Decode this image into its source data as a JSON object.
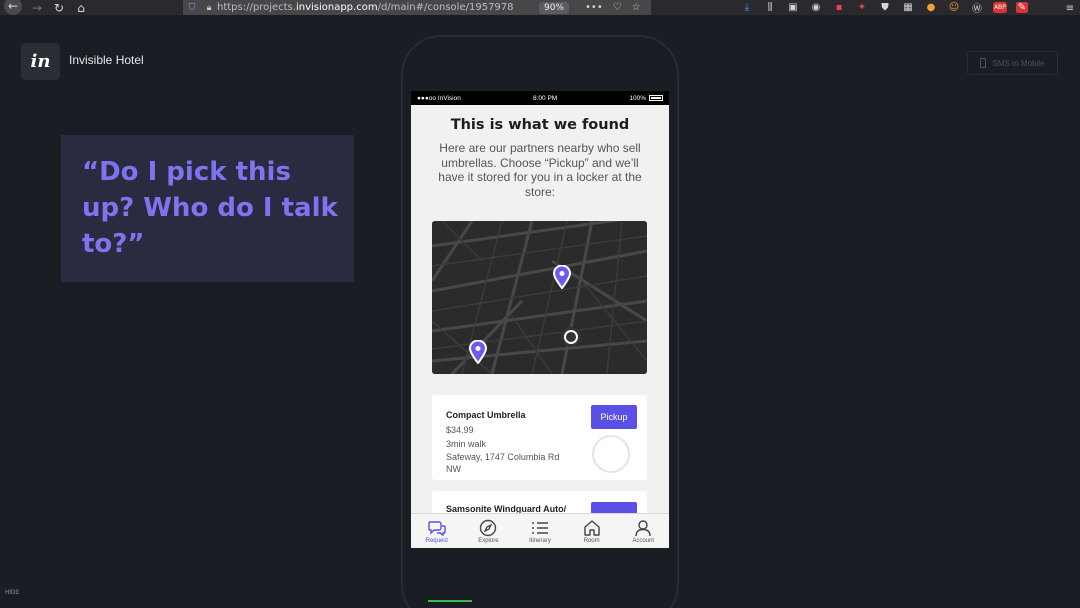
{
  "browser": {
    "url_prefix": "https://projects.",
    "url_domain": "invisionapp.com",
    "url_path": "/d/main#/console/1957978",
    "zoom": "90%"
  },
  "header": {
    "logo_text": "in",
    "project_title": "Invisible Hotel",
    "sms_label": "SMS to Mobile"
  },
  "quote": {
    "text": "“Do I pick this up? Who do I talk to?”"
  },
  "phone": {
    "status": {
      "carrier": "●●●oo InVision",
      "time": "8:00 PM",
      "battery": "100%"
    },
    "heading": "This is what we found",
    "description": "Here are our partners nearby who sell umbrellas. Choose “Pickup” and we’ll have it stored for you in a locker at the store:",
    "products": [
      {
        "name": "Compact Umbrella",
        "price": "$34.99",
        "walk": "3min walk",
        "store": "Safeway, 1747 Columbia Rd NW",
        "action": "Pickup"
      },
      {
        "name": "Samsonite Windguard Auto/"
      }
    ],
    "tabs": [
      {
        "label": "Request",
        "icon": "chat-bubbles-icon",
        "active": true
      },
      {
        "label": "Explore",
        "icon": "compass-icon",
        "active": false
      },
      {
        "label": "Itinerary",
        "icon": "list-icon",
        "active": false
      },
      {
        "label": "Room",
        "icon": "house-icon",
        "active": false
      },
      {
        "label": "Account",
        "icon": "user-icon",
        "active": false
      }
    ]
  },
  "footer": {
    "hide_label": "HIDE"
  },
  "colors": {
    "background": "#1b1d24",
    "accent": "#5b50e5",
    "quote_text": "#7f74f0",
    "quote_card": "#2a2b40",
    "progress": "#3fb950"
  }
}
